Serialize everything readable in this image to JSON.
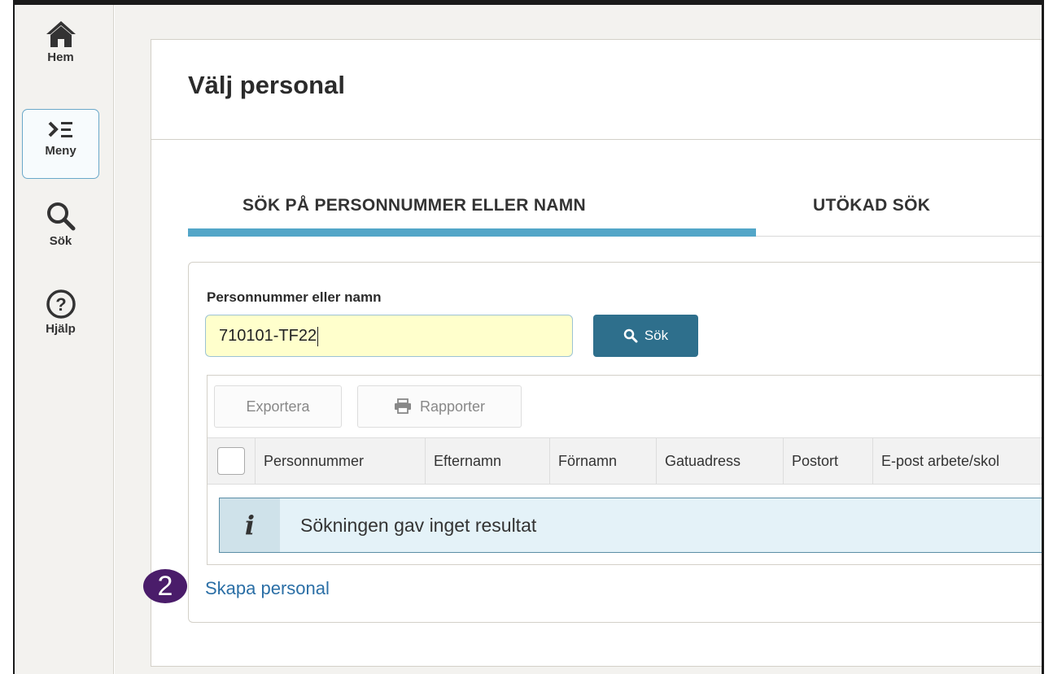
{
  "sidebar": {
    "items": [
      {
        "label": "Hem",
        "icon": "home-icon"
      },
      {
        "label": "Meny",
        "icon": "menu-icon"
      },
      {
        "label": "Sök",
        "icon": "search-icon"
      },
      {
        "label": "Hjälp",
        "icon": "help-icon"
      }
    ],
    "active": "Meny"
  },
  "page": {
    "title": "Välj personal"
  },
  "tabs": [
    {
      "label": "SÖK PÅ PERSONNUMMER ELLER NAMN",
      "active": true
    },
    {
      "label": "UTÖKAD SÖK",
      "active": false
    }
  ],
  "search": {
    "label": "Personnummer eller namn",
    "value": "710101-TF22",
    "button_label": "Sök"
  },
  "toolbar": {
    "export_label": "Exportera",
    "reports_label": "Rapporter"
  },
  "table": {
    "columns": [
      "Personnummer",
      "Efternamn",
      "Förnamn",
      "Gatuadress",
      "Postort",
      "E-post arbete/skol"
    ]
  },
  "info": {
    "message": "Sökningen gav inget resultat",
    "icon": "info-icon"
  },
  "create_link": "Skapa personal",
  "badge": "2",
  "colors": {
    "accent": "#53a6c8",
    "button": "#2e6f8c",
    "link": "#2b6fa6",
    "input_bg": "#ffffcc",
    "badge": "#4a1c6a"
  }
}
